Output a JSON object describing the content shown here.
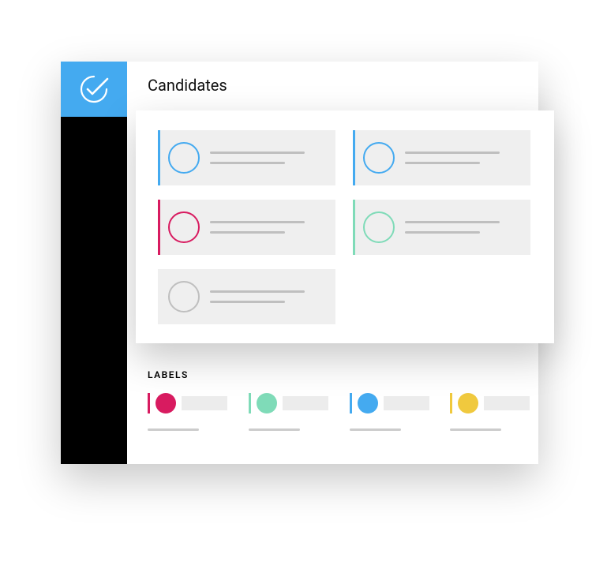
{
  "header": {
    "title": "Candidates"
  },
  "labels_section": {
    "heading": "LABELS",
    "items": [
      {
        "color": "#d81b60"
      },
      {
        "color": "#7fdbb8"
      },
      {
        "color": "#44aaf0"
      },
      {
        "color": "#f0c93e"
      }
    ]
  },
  "candidates": {
    "cards": [
      {
        "accent": "#44aaf0",
        "circle": "#44aaf0"
      },
      {
        "accent": "#44aaf0",
        "circle": "#44aaf0"
      },
      {
        "accent": "#d81b60",
        "circle": "#d81b60"
      },
      {
        "accent": "#7fdbb8",
        "circle": "#7fdbb8"
      },
      {
        "accent": "none",
        "circle": "#bfbfbf"
      }
    ]
  },
  "colors": {
    "brand": "#44aaf0",
    "sidebar": "#000000"
  }
}
